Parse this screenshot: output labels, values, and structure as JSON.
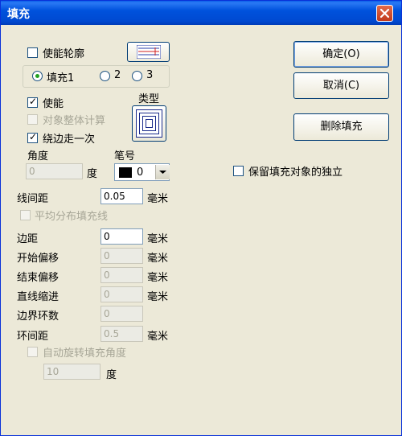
{
  "window": {
    "title": "填充"
  },
  "outline": {
    "enable_label": "使能轮廓"
  },
  "fill_tabs": [
    "填充1",
    "2",
    "3"
  ],
  "fill": {
    "enable_label": "使能",
    "whole_object_label": "对象整体计算",
    "edge_once_label": "绕边走一次",
    "type_label": "类型",
    "angle_label": "角度",
    "angle_value": "0",
    "degree_unit": "度",
    "pen_label": "笔号",
    "pen_value": "0",
    "line_spacing_label": "线间距",
    "line_spacing_value": "0.05",
    "mm": "毫米",
    "even_distribute_label": "平均分布填充线",
    "margin_label": "边距",
    "margin_value": "0",
    "start_offset_label": "开始偏移",
    "start_offset_value": "0",
    "end_offset_label": "结束偏移",
    "end_offset_value": "0",
    "line_indent_label": "直线缩进",
    "line_indent_value": "0",
    "border_loops_label": "边界环数",
    "border_loops_value": "0",
    "ring_spacing_label": "环间距",
    "ring_spacing_value": "0.5",
    "auto_rotate_label": "自动旋转填充角度",
    "auto_rotate_value": "10"
  },
  "buttons": {
    "ok": "确定(O)",
    "cancel": "取消(C)",
    "delete_fill": "删除填充"
  },
  "keep_independent_label": "保留填充对象的独立"
}
